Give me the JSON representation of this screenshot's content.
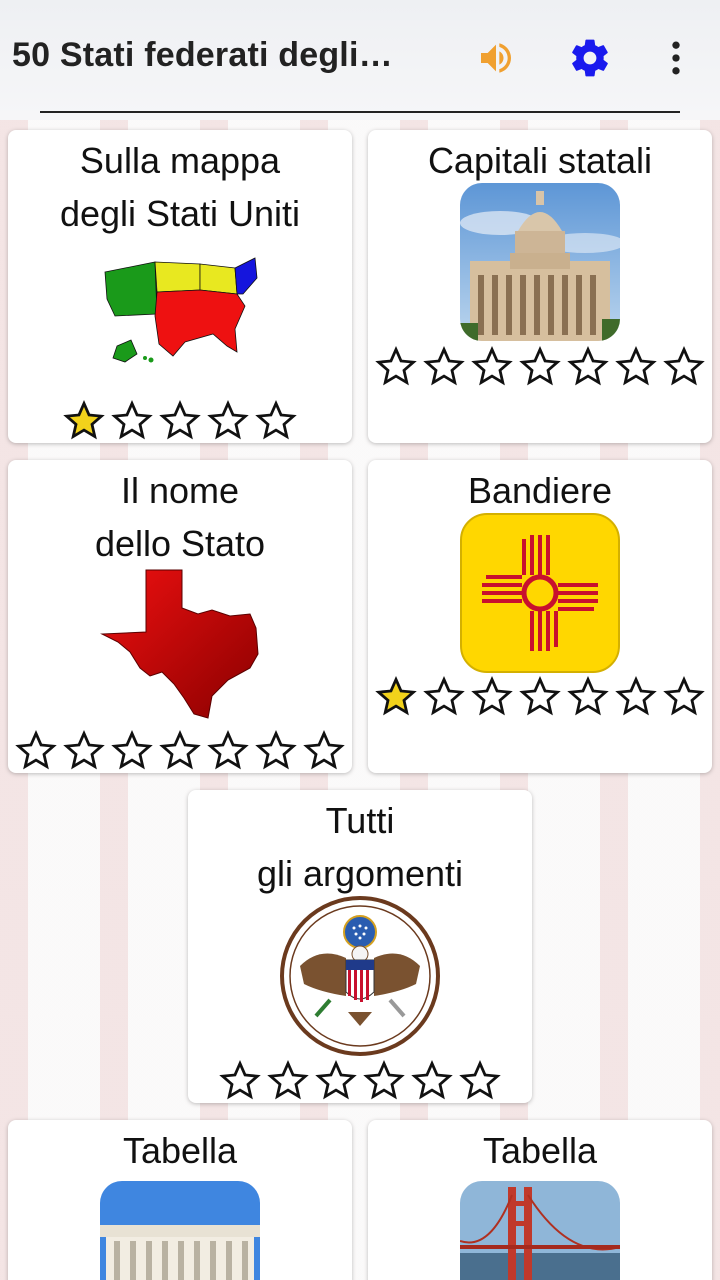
{
  "app": {
    "title": "50 Stati federati degli…",
    "icons": {
      "sound": "speaker-icon",
      "settings": "gear-icon",
      "more": "more-vert-icon"
    },
    "colors": {
      "sound": "#F0A030",
      "settings": "#1A1AEE",
      "star_filled": "#F2D21B"
    }
  },
  "cards": [
    {
      "title_line1": "Sulla mappa",
      "title_line2": "degli Stati Uniti",
      "image": "us-map-icon",
      "stars_total": 5,
      "stars_filled": 1
    },
    {
      "title_line1": "Capitali statali",
      "title_line2": "",
      "image": "capitol-building-image",
      "stars_total": 7,
      "stars_filled": 0
    },
    {
      "title_line1": "Il nome",
      "title_line2": "dello Stato",
      "image": "texas-shape-icon",
      "stars_total": 7,
      "stars_filled": 0
    },
    {
      "title_line1": "Bandiere",
      "title_line2": "",
      "image": "new-mexico-flag-icon",
      "stars_total": 7,
      "stars_filled": 1
    },
    {
      "title_line1": "Tutti",
      "title_line2": "gli argomenti",
      "image": "great-seal-icon",
      "stars_total": 6,
      "stars_filled": 0
    },
    {
      "title_line1": "Tabella",
      "title_line2": "",
      "image": "lincoln-memorial-image",
      "stars_total": 0,
      "stars_filled": 0
    },
    {
      "title_line1": "Tabella",
      "title_line2": "",
      "image": "golden-gate-bridge-image",
      "stars_total": 0,
      "stars_filled": 0
    }
  ]
}
